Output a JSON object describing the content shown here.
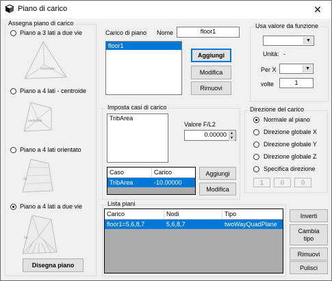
{
  "window": {
    "title": "Piano di carico",
    "close_glyph": "✕"
  },
  "assign_group": {
    "legend": "Assegna piano di carico",
    "options": [
      {
        "label": "Piano a 3 lati a due vie",
        "checked": false,
        "preview_label": "centroide"
      },
      {
        "label": "Piano a 4 lati - centroide",
        "checked": false,
        "preview_label": "centroide"
      },
      {
        "label": "Piano a 4 lati orientato",
        "checked": false,
        "preview_label": "1a"
      },
      {
        "label": "Piano a 4 lati a due vie",
        "checked": true,
        "preview_label": "1a"
      }
    ],
    "draw_button": "Disegna piano"
  },
  "load_plane": {
    "label": "Carico di piano",
    "name_label": "Nome",
    "name_value": "floor1",
    "list_items": [
      "floor1"
    ],
    "add_button": "Aggiungi",
    "edit_button": "Modifica",
    "remove_button": "Rimuovi"
  },
  "function_group": {
    "legend": "Usa valore da funzione",
    "combo_value": "",
    "units_label": "Unità:",
    "units_value": "-",
    "per_x_label": "Per X",
    "per_x_value": "",
    "times_label": "volte",
    "times_value": "1"
  },
  "load_cases": {
    "legend": "Imposta casi di carico",
    "case_list": [
      "TribArea"
    ],
    "value_label": "Valore F/L2",
    "value": "0.00000",
    "columns": [
      "Caso",
      "Carico"
    ],
    "rows": [
      {
        "case": "TribArea",
        "load": "-10.00000"
      }
    ],
    "add_button": "Aggiungi",
    "edit_button": "Modifica"
  },
  "direction_group": {
    "legend": "Direzione del carico",
    "options": [
      {
        "label": "Normale al piano",
        "checked": true
      },
      {
        "label": "Direzione globale X",
        "checked": false
      },
      {
        "label": "Direzione globale Y",
        "checked": false
      },
      {
        "label": "Direzione globale Z",
        "checked": false
      },
      {
        "label": "Specifica direzione",
        "checked": false
      }
    ],
    "vector": [
      "1",
      "0",
      "0"
    ]
  },
  "plane_list": {
    "legend": "Lista piani",
    "columns": [
      "Carico",
      "Nodi",
      "Tipo"
    ],
    "rows": [
      {
        "load": "floor1=5,6,8,7",
        "nodes": "5,6,8,7",
        "type": "twoWayQuadPlane"
      }
    ],
    "invert_button": "Inverti",
    "change_type_button_line1": "Cambia",
    "change_type_button_line2": "tipo",
    "remove_button": "Rimuovi",
    "clear_button": "Pulisci"
  }
}
